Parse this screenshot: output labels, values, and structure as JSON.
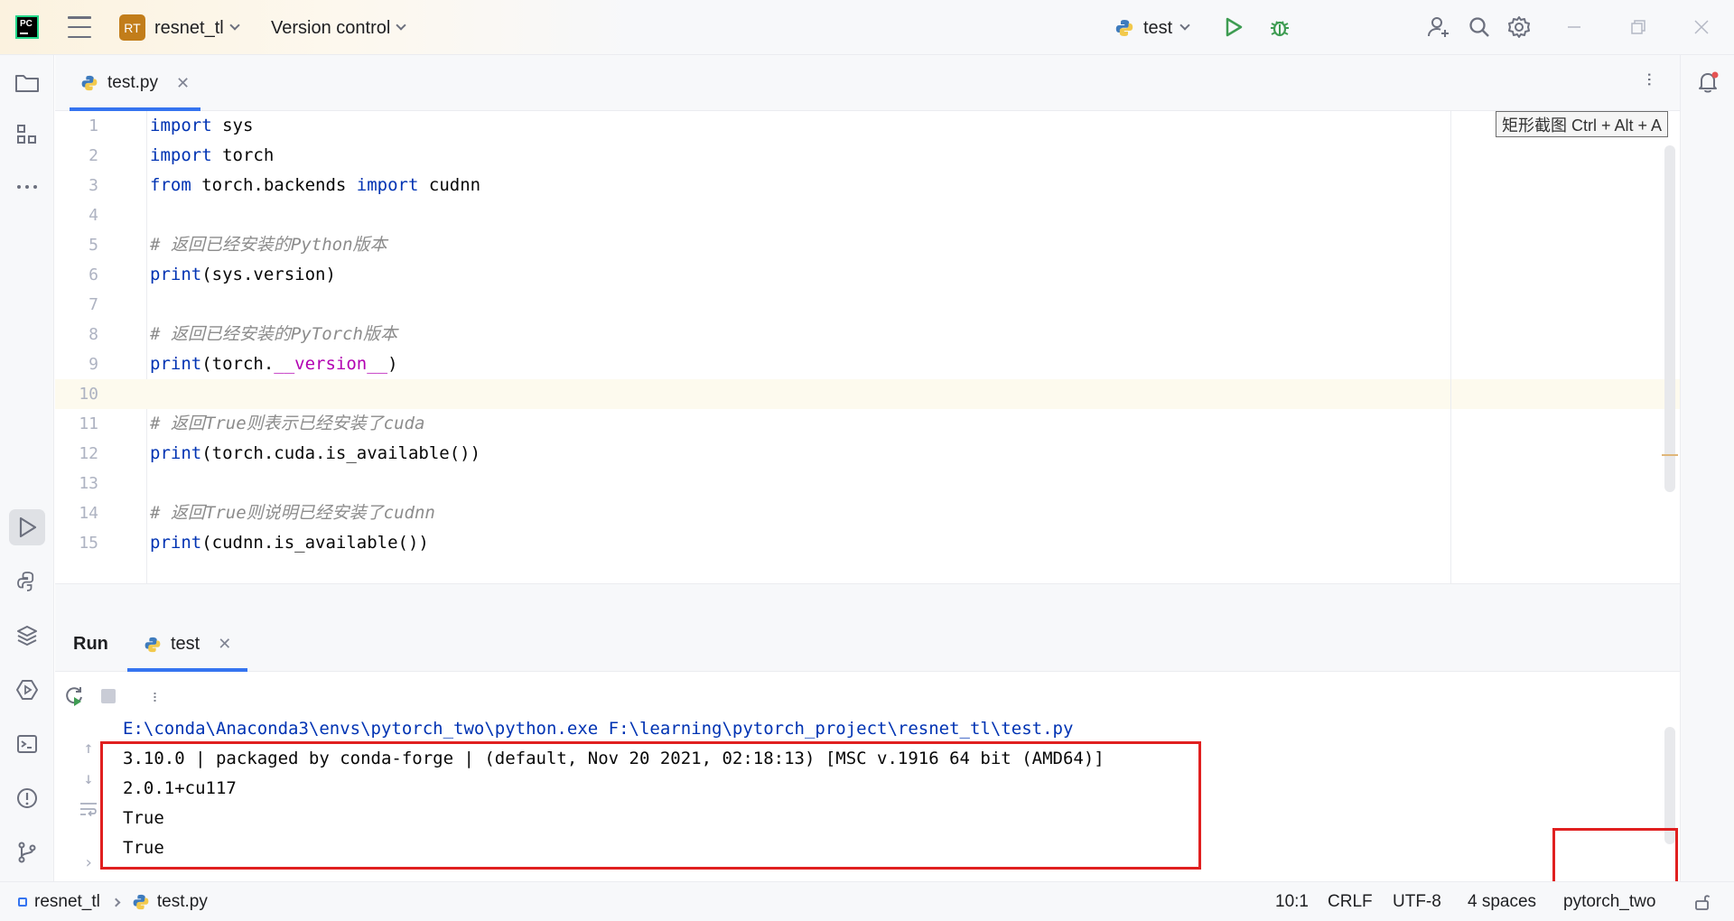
{
  "titlebar": {
    "project_badge": "RT",
    "project_name": "resnet_tl",
    "version_control": "Version control",
    "run_config": "test"
  },
  "editor": {
    "tab_label": "test.py",
    "tooltip": "矩形截图 Ctrl + Alt + A",
    "current_line": 10,
    "lines": [
      {
        "num": "1",
        "tokens": [
          {
            "t": "import",
            "c": "kw"
          },
          {
            "t": " sys",
            "c": ""
          }
        ]
      },
      {
        "num": "2",
        "tokens": [
          {
            "t": "import",
            "c": "kw"
          },
          {
            "t": " torch",
            "c": ""
          }
        ]
      },
      {
        "num": "3",
        "tokens": [
          {
            "t": "from",
            "c": "kw"
          },
          {
            "t": " torch.backends ",
            "c": ""
          },
          {
            "t": "import",
            "c": "kw"
          },
          {
            "t": " cudnn",
            "c": ""
          }
        ]
      },
      {
        "num": "4",
        "tokens": []
      },
      {
        "num": "5",
        "tokens": [
          {
            "t": "# 返回已经安装的Python版本",
            "c": "cm"
          }
        ]
      },
      {
        "num": "6",
        "tokens": [
          {
            "t": "print",
            "c": "kw"
          },
          {
            "t": "(sys.version)",
            "c": ""
          }
        ]
      },
      {
        "num": "7",
        "tokens": []
      },
      {
        "num": "8",
        "tokens": [
          {
            "t": "# 返回已经安装的PyTorch版本",
            "c": "cm"
          }
        ]
      },
      {
        "num": "9",
        "tokens": [
          {
            "t": "print",
            "c": "kw"
          },
          {
            "t": "(torch.",
            "c": ""
          },
          {
            "t": "__version__",
            "c": "dunder"
          },
          {
            "t": ")",
            "c": ""
          }
        ]
      },
      {
        "num": "10",
        "tokens": []
      },
      {
        "num": "11",
        "tokens": [
          {
            "t": "# 返回True则表示已经安装了cuda",
            "c": "cm"
          }
        ]
      },
      {
        "num": "12",
        "tokens": [
          {
            "t": "print",
            "c": "kw"
          },
          {
            "t": "(torch.cuda.is_available())",
            "c": ""
          }
        ]
      },
      {
        "num": "13",
        "tokens": []
      },
      {
        "num": "14",
        "tokens": [
          {
            "t": "# 返回True则说明已经安装了cudnn",
            "c": "cm"
          }
        ]
      },
      {
        "num": "15",
        "tokens": [
          {
            "t": "print",
            "c": "kw"
          },
          {
            "t": "(cudnn.is_available())",
            "c": ""
          }
        ]
      }
    ]
  },
  "run_panel": {
    "title": "Run",
    "tab_label": "test",
    "command": "E:\\conda\\Anaconda3\\envs\\pytorch_two\\python.exe F:\\learning\\pytorch_project\\resnet_tl\\test.py",
    "output": [
      "3.10.0 | packaged by conda-forge | (default, Nov 20 2021, 02:18:13) [MSC v.1916 64 bit (AMD64)]",
      "2.0.1+cu117",
      "True",
      "True"
    ]
  },
  "statusbar": {
    "project": "resnet_tl",
    "file": "test.py",
    "position": "10:1",
    "line_sep": "CRLF",
    "encoding": "UTF-8",
    "indent": "4 spaces",
    "interpreter": "pytorch_two"
  },
  "colors": {
    "accent": "#3574f0",
    "keyword": "#0033b3",
    "comment": "#8c8c8c",
    "dunder": "#b200b2",
    "highlight_box": "#e02020",
    "run_green": "#3e9c52",
    "project_badge": "#c27d1a"
  }
}
